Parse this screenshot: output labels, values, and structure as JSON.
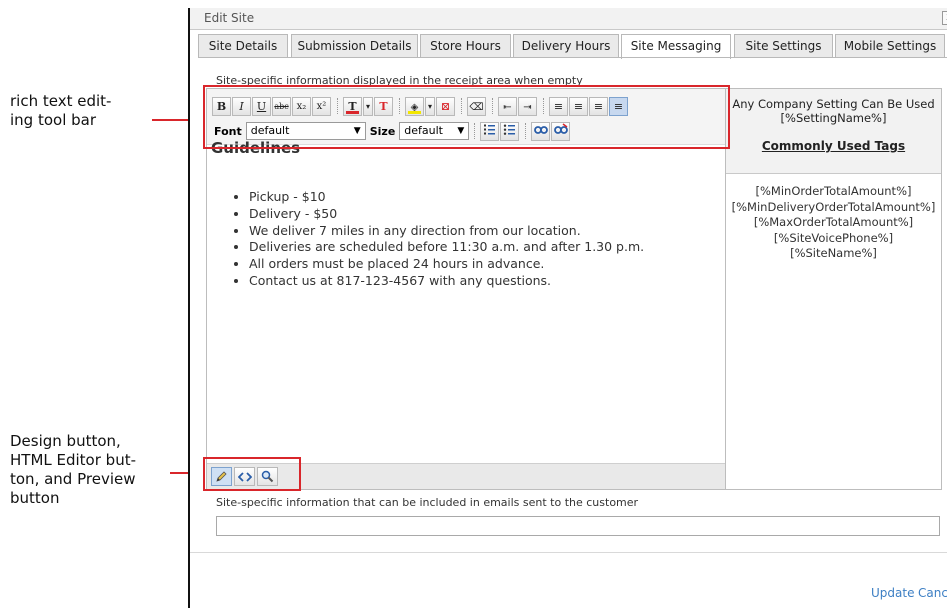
{
  "callouts": {
    "toolbar": [
      "rich text edit-",
      "ing tool bar"
    ],
    "buttons": [
      "Design button,",
      "HTML Editor but-",
      "ton, and Preview",
      "button"
    ]
  },
  "dialog": {
    "title": "Edit Site",
    "close_glyph": "x"
  },
  "tabs": [
    {
      "label": "Site Details",
      "active": false
    },
    {
      "label": "Submission Details",
      "active": false
    },
    {
      "label": "Store Hours",
      "active": false
    },
    {
      "label": "Delivery Hours",
      "active": false
    },
    {
      "label": "Site Messaging",
      "active": true
    },
    {
      "label": "Site Settings",
      "active": false
    },
    {
      "label": "Mobile Settings",
      "active": false
    }
  ],
  "receipt_section": {
    "description": "Site-specific information displayed in the receipt area when empty"
  },
  "toolbar": {
    "row1": [
      "B",
      "I",
      "U",
      "abc",
      "x₂",
      "x²",
      "T",
      "▾",
      "T",
      "◈",
      "▾",
      "⊠",
      "⌫",
      "⇤",
      "⇥",
      "≡",
      "≡",
      "≡",
      "≡"
    ],
    "font_label": "Font",
    "font_value": "default",
    "size_label": "Size",
    "size_value": "default"
  },
  "editor": {
    "heading": "Guidelines",
    "items": [
      "Pickup - $10",
      "Delivery - $50",
      "We deliver 7 miles in any direction from our location.",
      "Deliveries are scheduled before 11:30 a.m. and after 1.30 p.m.",
      "All orders must be placed 24 hours in advance.",
      "Contact us at 817-123-4567 with any questions."
    ]
  },
  "tag_panel": {
    "line1": "Any Company Setting Can Be Used",
    "line2": "[%SettingName%]",
    "heading": "Commonly Used Tags",
    "tags": [
      "[%MinOrderTotalAmount%]",
      "[%MinDeliveryOrderTotalAmount%]",
      "[%MaxOrderTotalAmount%]",
      "[%SiteVoicePhone%]",
      "[%SiteName%]"
    ]
  },
  "email_section": {
    "description": "Site-specific information that can be included in emails sent to the customer",
    "value": ""
  },
  "footer": {
    "update_label": "Update",
    "cancel_label": "Canc"
  },
  "colors": {
    "callout_red": "#d9262b",
    "link_blue": "#3d7fc4"
  }
}
